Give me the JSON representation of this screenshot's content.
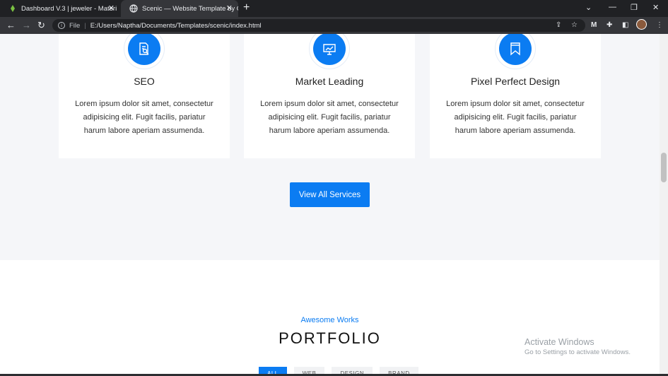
{
  "browser": {
    "tabs": [
      {
        "title": "Dashboard V.3 | jeweler - Materi"
      },
      {
        "title": "Scenic — Website Template by C"
      }
    ],
    "new_tab": "+",
    "address": {
      "scheme_label": "File",
      "url": "E:/Users/Naptha/Documents/Templates/scenic/index.html"
    },
    "toolbar_extension": "M"
  },
  "services": {
    "cards": [
      {
        "title": "SEO",
        "text": "Lorem ipsum dolor sit amet, consectetur adipisicing elit. Fugit facilis, pariatur harum labore aperiam assumenda.",
        "icon": "document-search-icon"
      },
      {
        "title": "Market Leading",
        "text": "Lorem ipsum dolor sit amet, consectetur adipisicing elit. Fugit facilis, pariatur harum labore aperiam assumenda.",
        "icon": "presentation-chart-icon"
      },
      {
        "title": "Pixel Perfect Design",
        "text": "Lorem ipsum dolor sit amet, consectetur adipisicing elit. Fugit facilis, pariatur harum labore aperiam assumenda.",
        "icon": "bookmark-icon"
      }
    ],
    "button_label": "View All Services"
  },
  "portfolio": {
    "kicker": "Awesome Works",
    "title": "PORTFOLIO",
    "filters": [
      "ALL",
      "WEB",
      "DESIGN",
      "BRAND"
    ]
  },
  "watermark": {
    "line1": "Activate Windows",
    "line2": "Go to Settings to activate Windows."
  },
  "colors": {
    "accent": "#0b7cf2",
    "chrome_dark": "#202124",
    "chrome_tab": "#35363a",
    "section_bg": "#f5f6f9"
  }
}
